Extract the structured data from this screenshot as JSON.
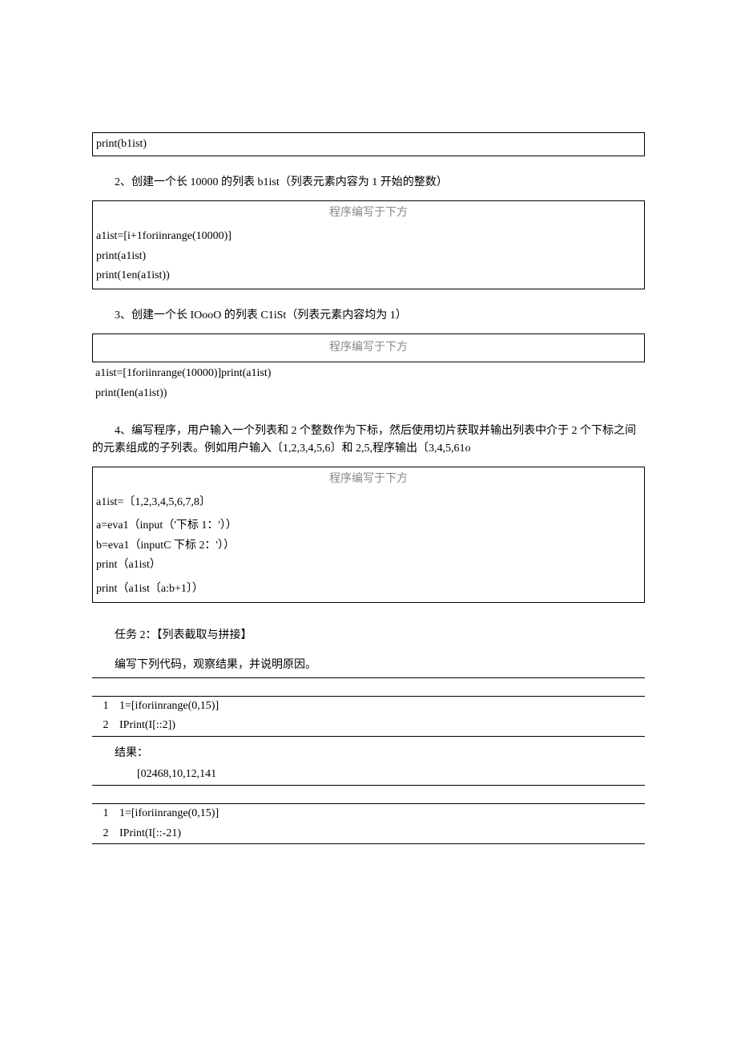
{
  "box1": {
    "line1": "print(b1ist)"
  },
  "q2": {
    "prompt": "2、创建一个长 10000 的列表 b1ist（列表元素内容为 1 开始的整数）",
    "header": "程序编写于下方",
    "l1": "a1ist=[i+1foriinrange(10000)]",
    "l2": "print(a1ist)",
    "l3": "print(1en(a1ist))"
  },
  "q3": {
    "prompt": "3、创建一个长 IOooO 的列表 C1iSt（列表元素内容均为 1）",
    "header": "程序编写于下方",
    "l1": "a1ist=[1foriinrange(10000)]print(a1ist)",
    "l2": "print(Ien(a1ist))"
  },
  "q4": {
    "prompt": "4、编写程序，用户输入一个列表和 2 个整数作为下标，然后使用切片获取并输出列表中介于 2 个下标之间的元素组成的子列表。例如用户输入〔1,2,3,4,5,6〕和 2,5,程序输出〔3,4,5,61o",
    "header": "程序编写于下方",
    "l1": "a1ist=〔1,2,3,4,5,6,7,8〕",
    "l2": "a=eva1（input（'下标 1：'））",
    "l3": "b=eva1（inputC 下标 2：'））",
    "l4": "print（a1ist）",
    "l5": "print（a1ist〔a:b+1〕）"
  },
  "task2": {
    "title": "任务 2：【列表截取与拼接】",
    "instr": "编写下列代码，观察结果，并说明原因。"
  },
  "blockA": {
    "n1": "1",
    "t1": "1=[iforiinrange(0,15)]",
    "n2": "2",
    "t2": "IPrint(I[::2])",
    "result_label": "结果：",
    "result_value": "[02468,10,12,141"
  },
  "blockB": {
    "n1": "1",
    "t1": "1=[iforiinrange(0,15)]",
    "n2": "2",
    "t2": "IPrint(I[::-21)"
  }
}
